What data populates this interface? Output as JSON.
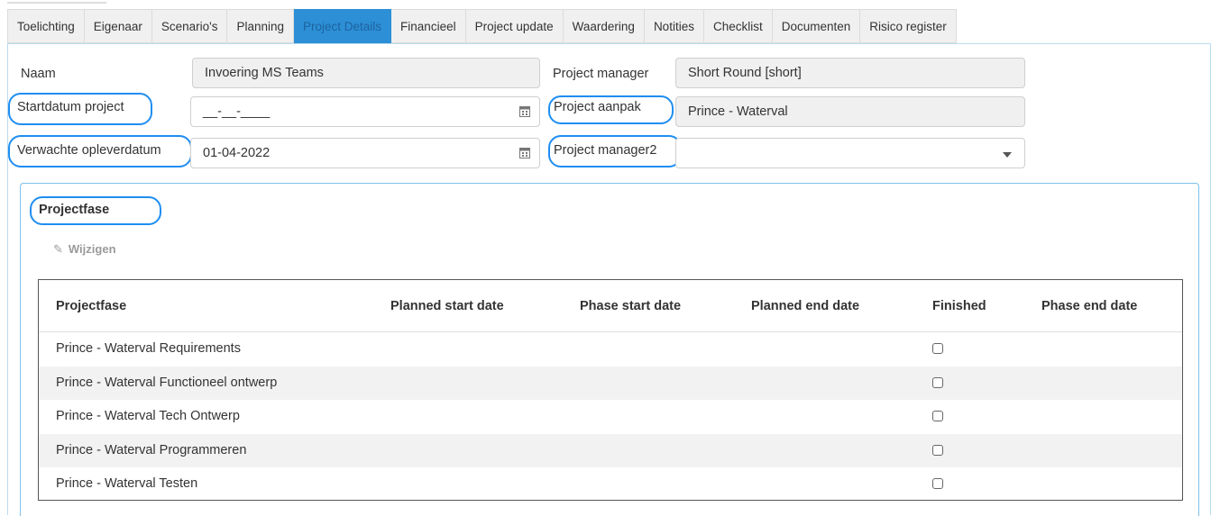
{
  "tabs": [
    {
      "label": "Toelichting"
    },
    {
      "label": "Eigenaar"
    },
    {
      "label": "Scenario's"
    },
    {
      "label": "Planning"
    },
    {
      "label": "Project Details",
      "active": true
    },
    {
      "label": "Financieel"
    },
    {
      "label": "Project update"
    },
    {
      "label": "Waardering"
    },
    {
      "label": "Notities"
    },
    {
      "label": "Checklist"
    },
    {
      "label": "Documenten"
    },
    {
      "label": "Risico register"
    }
  ],
  "form": {
    "naam_label": "Naam",
    "naam_value": "Invoering MS Teams",
    "startdatum_label": "Startdatum project",
    "startdatum_value": "__-__-____",
    "verwachte_label": "Verwachte opleverdatum",
    "verwachte_value": "01-04-2022",
    "pm_label": "Project manager",
    "pm_value": "Short Round [short]",
    "aanpak_label": "Project aanpak",
    "aanpak_value": "Prince - Waterval",
    "pm2_label": "Project manager2",
    "pm2_value": ""
  },
  "phase_section": {
    "title": "Projectfase",
    "edit_label": "Wijzigen",
    "columns": [
      "Projectfase",
      "Planned start date",
      "Phase start date",
      "Planned end date",
      "Finished",
      "Phase end date"
    ],
    "rows": [
      {
        "name": "Prince - Waterval Requirements",
        "finished": false
      },
      {
        "name": "Prince - Waterval Functioneel ontwerp",
        "finished": false
      },
      {
        "name": "Prince - Waterval Tech Ontwerp",
        "finished": false
      },
      {
        "name": "Prince - Waterval Programmeren",
        "finished": false
      },
      {
        "name": "Prince - Waterval Testen",
        "finished": false
      }
    ]
  },
  "colors": {
    "accent": "#2d8fd6",
    "highlight": "#1f8ef1",
    "readonly_bg": "#f0f0f0"
  },
  "icons": {
    "calendar": "calendar-icon",
    "dropdown": "chevron-down-icon",
    "edit": "pencil-icon"
  }
}
